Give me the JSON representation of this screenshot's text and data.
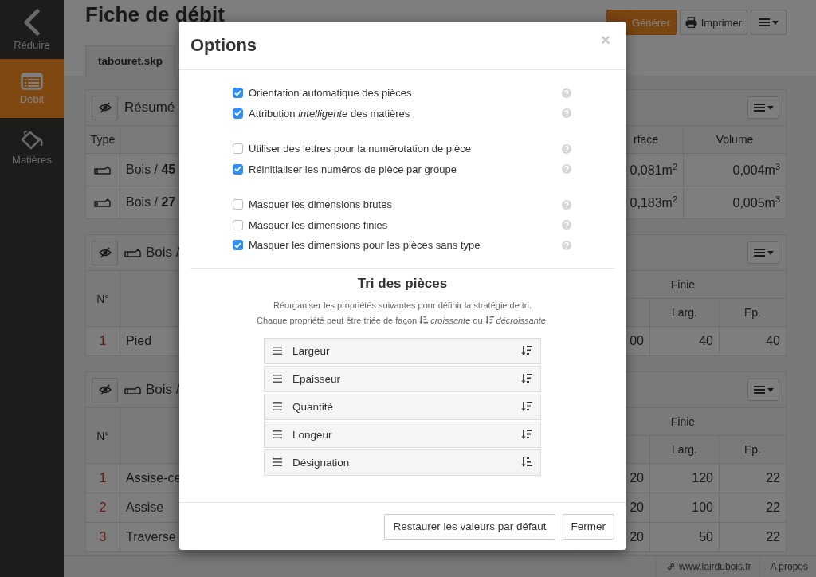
{
  "sidebar": {
    "items": [
      {
        "label": "Réduire",
        "selected": false
      },
      {
        "label": "Débit",
        "selected": true
      },
      {
        "label": "Matières",
        "selected": false
      }
    ]
  },
  "header": {
    "title": "Fiche de débit",
    "buttons": [
      {
        "kind": "primary",
        "label": "Générer"
      },
      {
        "kind": "print",
        "label": "Imprimer"
      },
      {
        "kind": "menu"
      }
    ]
  },
  "tabs": [
    {
      "label": "tabouret.skp",
      "selected": true
    }
  ],
  "panels": [
    {
      "kind": "summary",
      "title": "Résumé",
      "columns": [
        "Type",
        "rface",
        "Volume"
      ],
      "rows": [
        {
          "cells": [
            "Bois / **45**",
            "0,081m$^{2}$",
            "0,004m$^{3}$"
          ]
        },
        {
          "cells": [
            "Bois / **27**",
            "0,183m$^{2}$",
            "0,005m$^{3}$"
          ]
        }
      ]
    },
    {
      "kind": "group",
      "title": "Bois /",
      "columns": [
        "N°",
        "Finie",
        "Larg.",
        "Ep."
      ],
      "rows": [
        {
          "cells": [
            "1",
            "Pied",
            "00",
            "40",
            "40"
          ]
        }
      ]
    },
    {
      "kind": "group",
      "title": "Bois /",
      "columns": [
        "N°",
        "Finie",
        "Larg.",
        "Ep."
      ],
      "rows": [
        {
          "cells": [
            "1",
            "Assise-ce",
            "20",
            "120",
            "22"
          ]
        },
        {
          "cells": [
            "2",
            "Assise",
            "20",
            "100",
            "22"
          ]
        },
        {
          "cells": [
            "3",
            "Traverse",
            "20",
            "50",
            "22"
          ]
        }
      ]
    }
  ],
  "status_bar": {
    "items": [
      {
        "kind": "link",
        "label": "www.lairdubois.fr"
      },
      {
        "kind": "plain",
        "label": "A propos"
      }
    ]
  },
  "dialog": {
    "title": "Options",
    "close_label": "×",
    "option_groups": [
      [
        {
          "label": "Orientation automatique des pièces",
          "checked": true
        },
        {
          "label": "Attribution *intelligente* des matières",
          "checked": true
        }
      ],
      [
        {
          "label": "Utiliser des lettres pour la numérotation de pièce",
          "checked": false
        },
        {
          "label": "Réinitialiser les numéros de pièce par groupe",
          "checked": true
        }
      ],
      [
        {
          "label": "Masquer les dimensions brutes",
          "checked": false
        },
        {
          "label": "Masquer les dimensions finies",
          "checked": false
        },
        {
          "label": "Masquer les dimensions pour les pièces sans type",
          "checked": true
        }
      ]
    ],
    "sorting": {
      "title": "Tri des pièces",
      "description": "Réorganiser les propriétés suivantes pour définir la stratégie de tri.",
      "hint": [
        {
          "kind": "text",
          "text": "Chaque propriété peut être triée de façon"
        },
        {
          "kind": "sort_icon",
          "descending": false
        },
        {
          "kind": "text",
          "text": "*croissante* ou"
        },
        {
          "kind": "sort_icon",
          "descending": true
        },
        {
          "kind": "text",
          "text": "*décroissante*."
        }
      ],
      "criteria": [
        {
          "label": "Largeur",
          "descending": true
        },
        {
          "label": "Epaisseur",
          "descending": true
        },
        {
          "label": "Quantité",
          "descending": true
        },
        {
          "label": "Longeur",
          "descending": true
        },
        {
          "label": "Désignation",
          "descending": false
        }
      ]
    },
    "buttons": [
      "Restaurer les valeurs par défaut",
      "Fermer"
    ]
  }
}
